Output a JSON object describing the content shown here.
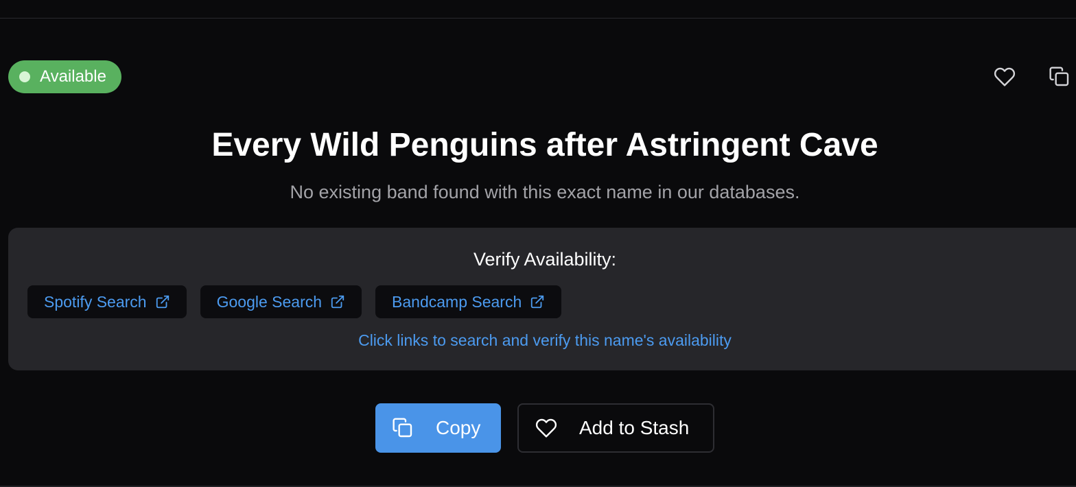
{
  "colors": {
    "background": "#0a0a0c",
    "available_green": "#59b15f",
    "panel_bg": "#26262a",
    "link_blue": "#4c9bf0",
    "copy_button_bg": "#4a94e8"
  },
  "status": {
    "label": "Available",
    "icon": "status-dot"
  },
  "header_actions": {
    "favorite_icon": "heart-icon",
    "copy_icon": "copy-icon"
  },
  "result": {
    "name": "Every Wild Penguins after Astringent Cave",
    "message": "No existing band found with this exact name in our databases."
  },
  "verify": {
    "heading": "Verify Availability:",
    "links": [
      {
        "label": "Spotify Search",
        "icon": "external-link-icon"
      },
      {
        "label": "Google Search",
        "icon": "external-link-icon"
      },
      {
        "label": "Bandcamp Search",
        "icon": "external-link-icon"
      }
    ],
    "hint": "Click links to search and verify this name's availability"
  },
  "actions": {
    "copy_label": "Copy",
    "copy_icon": "copy-icon",
    "stash_label": "Add to Stash",
    "stash_icon": "heart-icon"
  }
}
